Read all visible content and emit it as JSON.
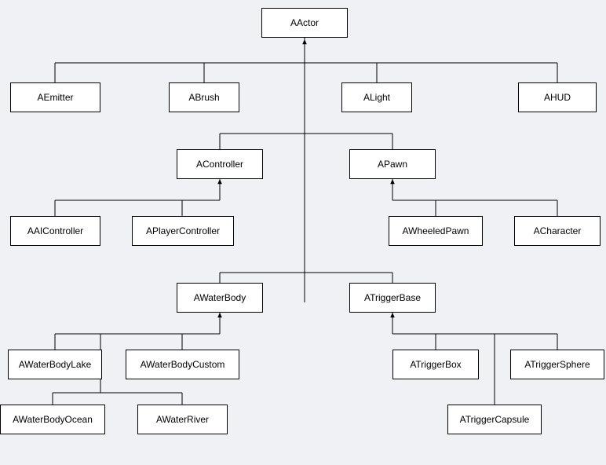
{
  "nodes": {
    "AActor": "AActor",
    "AEmitter": "AEmitter",
    "ABrush": "ABrush",
    "ALight": "ALight",
    "AHUD": "AHUD",
    "AController": "AController",
    "APawn": "APawn",
    "AAIController": "AAIController",
    "APlayerController": "APlayerController",
    "AWheeledPawn": "AWheeledPawn",
    "ACharacter": "ACharacter",
    "AWaterBody": "AWaterBody",
    "ATriggerBase": "ATriggerBase",
    "AWaterBodyLake": "AWaterBodyLake",
    "AWaterBodyCustom": "AWaterBodyCustom",
    "AWaterBodyOcean": "AWaterBodyOcean",
    "AWaterRiver": "AWaterRiver",
    "ATriggerBox": "ATriggerBox",
    "ATriggerSphere": "ATriggerSphere",
    "ATriggerCapsule": "ATriggerCapsule"
  },
  "hierarchy": {
    "AActor": [
      "AEmitter",
      "ABrush",
      "ALight",
      "AHUD",
      "AController",
      "APawn",
      "AWaterBody",
      "ATriggerBase"
    ],
    "AController": [
      "AAIController",
      "APlayerController"
    ],
    "APawn": [
      "AWheeledPawn",
      "ACharacter"
    ],
    "AWaterBody": [
      "AWaterBodyLake",
      "AWaterBodyCustom",
      "AWaterBodyOcean",
      "AWaterRiver"
    ],
    "ATriggerBase": [
      "ATriggerBox",
      "ATriggerSphere",
      "ATriggerCapsule"
    ]
  },
  "colors": {
    "background": "#f0f1f4",
    "node_fill": "#ffffff",
    "node_border": "#000000",
    "line": "#000000"
  }
}
